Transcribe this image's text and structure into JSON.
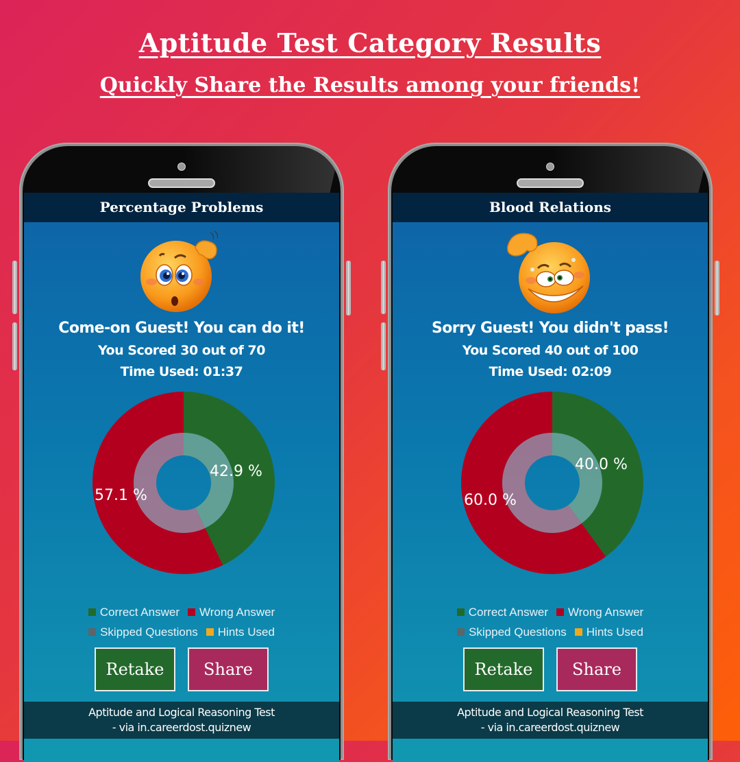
{
  "page": {
    "title": "Aptitude Test Category Results",
    "subtitle": "Quickly Share the Results among your friends!"
  },
  "colors": {
    "correct": "#236a2a",
    "wrong": "#b4001f",
    "skipped": "#5f6468",
    "hints": "#f0a81e",
    "retake_button": "#23692b",
    "share_button": "#a82a5d",
    "app_bar": "#032440"
  },
  "legend": {
    "correct": "Correct Answer",
    "wrong": "Wrong Answer",
    "skipped": "Skipped Questions",
    "hints": "Hints Used"
  },
  "buttons": {
    "retake": "Retake",
    "share": "Share"
  },
  "footer": {
    "line1": "Aptitude and Logical Reasoning Test",
    "line2": "- via in.careerdost.quiznew"
  },
  "phones": [
    {
      "category": "Percentage Problems",
      "emoji": "confused-thinking-emoji",
      "message": "Come-on Guest! You can do it!",
      "score": "You Scored 30 out of 70",
      "time": "Time Used: 01:37",
      "correct_label": "42.9 %",
      "wrong_label": "57.1 %"
    },
    {
      "category": "Blood Relations",
      "emoji": "nervous-grimace-emoji",
      "message": "Sorry Guest! You didn't pass!",
      "score": "You Scored 40 out of 100",
      "time": "Time Used: 02:09",
      "correct_label": "40.0 %",
      "wrong_label": "60.0 %"
    }
  ],
  "chart_data": [
    {
      "type": "pie",
      "title": "Percentage Problems",
      "categories": [
        "Correct Answer",
        "Wrong Answer",
        "Skipped Questions",
        "Hints Used"
      ],
      "values": [
        42.9,
        57.1,
        0,
        0
      ],
      "labels": [
        "42.9 %",
        "57.1 %"
      ],
      "donut": true,
      "legend": "bottom"
    },
    {
      "type": "pie",
      "title": "Blood Relations",
      "categories": [
        "Correct Answer",
        "Wrong Answer",
        "Skipped Questions",
        "Hints Used"
      ],
      "values": [
        40.0,
        60.0,
        0,
        0
      ],
      "labels": [
        "40.0 %",
        "60.0 %"
      ],
      "donut": true,
      "legend": "bottom"
    }
  ]
}
